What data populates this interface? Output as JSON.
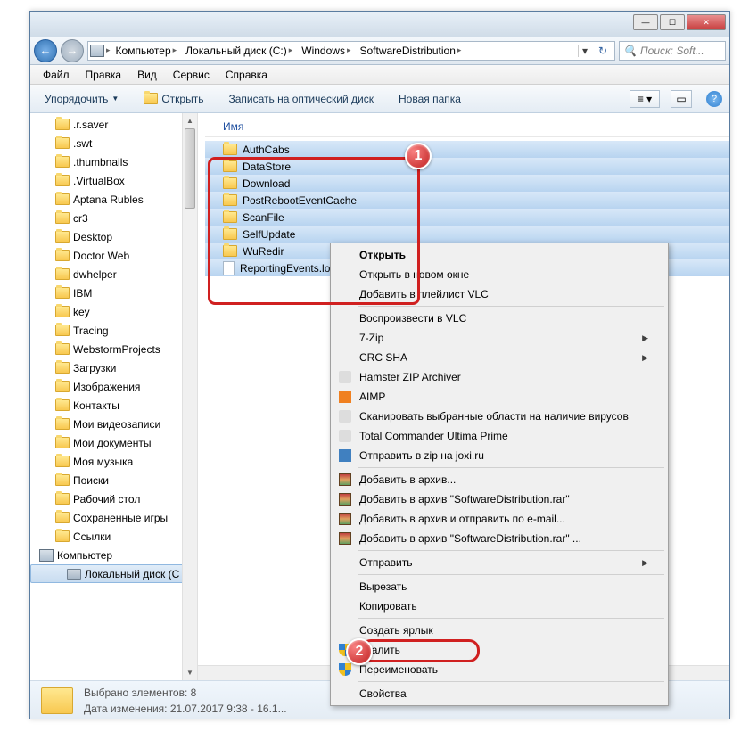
{
  "window": {
    "min": "—",
    "max": "☐",
    "close": "✕"
  },
  "nav": {
    "back": "←",
    "forward": "→",
    "refresh": "↻",
    "search_placeholder": "Поиск: Soft..."
  },
  "breadcrumbs": [
    "Компьютер",
    "Локальный диск (C:)",
    "Windows",
    "SoftwareDistribution"
  ],
  "menu": [
    "Файл",
    "Правка",
    "Вид",
    "Сервис",
    "Справка"
  ],
  "toolbar": {
    "organize": "Упорядочить",
    "open": "Открыть",
    "burn": "Записать на оптический диск",
    "newfolder": "Новая папка",
    "help": "?"
  },
  "sidebar": {
    "items": [
      {
        "label": ".r.saver",
        "icon": "folder",
        "indent": 1
      },
      {
        "label": ".swt",
        "icon": "folder",
        "indent": 1
      },
      {
        "label": ".thumbnails",
        "icon": "folder",
        "indent": 1
      },
      {
        "label": ".VirtualBox",
        "icon": "folder",
        "indent": 1
      },
      {
        "label": "Aptana Rubles",
        "icon": "folder",
        "indent": 1
      },
      {
        "label": "cr3",
        "icon": "folder",
        "indent": 1
      },
      {
        "label": "Desktop",
        "icon": "folder",
        "indent": 1
      },
      {
        "label": "Doctor Web",
        "icon": "folder",
        "indent": 1
      },
      {
        "label": "dwhelper",
        "icon": "folder",
        "indent": 1
      },
      {
        "label": "IBM",
        "icon": "folder",
        "indent": 1
      },
      {
        "label": "key",
        "icon": "folder",
        "indent": 1
      },
      {
        "label": "Tracing",
        "icon": "folder",
        "indent": 1
      },
      {
        "label": "WebstormProjects",
        "icon": "folder",
        "indent": 1
      },
      {
        "label": "Загрузки",
        "icon": "folder",
        "indent": 1
      },
      {
        "label": "Изображения",
        "icon": "folder",
        "indent": 1
      },
      {
        "label": "Контакты",
        "icon": "folder",
        "indent": 1
      },
      {
        "label": "Мои видеозаписи",
        "icon": "folder",
        "indent": 1
      },
      {
        "label": "Мои документы",
        "icon": "folder",
        "indent": 1
      },
      {
        "label": "Моя музыка",
        "icon": "folder",
        "indent": 1
      },
      {
        "label": "Поиски",
        "icon": "folder",
        "indent": 1
      },
      {
        "label": "Рабочий стол",
        "icon": "folder",
        "indent": 1
      },
      {
        "label": "Сохраненные игры",
        "icon": "folder",
        "indent": 1
      },
      {
        "label": "Ссылки",
        "icon": "folder",
        "indent": 1
      },
      {
        "label": "Компьютер",
        "icon": "computer",
        "indent": 0
      },
      {
        "label": "Локальный диск (C",
        "icon": "drive",
        "indent": 2,
        "selected": true
      }
    ]
  },
  "filepane": {
    "header": "Имя",
    "items": [
      {
        "name": "AuthCabs",
        "icon": "folder",
        "sel": true
      },
      {
        "name": "DataStore",
        "icon": "folder",
        "sel": true
      },
      {
        "name": "Download",
        "icon": "folder",
        "sel": true
      },
      {
        "name": "PostRebootEventCache",
        "icon": "folder",
        "sel": true
      },
      {
        "name": "ScanFile",
        "icon": "folder",
        "sel": true
      },
      {
        "name": "SelfUpdate",
        "icon": "folder",
        "sel": true
      },
      {
        "name": "WuRedir",
        "icon": "folder",
        "sel": true
      },
      {
        "name": "ReportingEvents.lo",
        "icon": "file",
        "sel": true
      }
    ]
  },
  "context_menu": [
    {
      "label": "Открыть",
      "bold": true
    },
    {
      "label": "Открыть в новом окне"
    },
    {
      "label": "Добавить в плейлист VLC"
    },
    {
      "sep": true
    },
    {
      "label": "Воспроизвести в VLC"
    },
    {
      "label": "7-Zip",
      "sub": true
    },
    {
      "label": "CRC SHA",
      "sub": true
    },
    {
      "label": "Hamster ZIP Archiver",
      "icon": "small"
    },
    {
      "label": "AIMP",
      "icon": "orange"
    },
    {
      "label": "Сканировать выбранные области на наличие вирусов",
      "icon": "small"
    },
    {
      "label": "Total Commander Ultima Prime",
      "icon": "small"
    },
    {
      "label": "Отправить в zip на joxi.ru",
      "icon": "blue"
    },
    {
      "sep": true
    },
    {
      "label": "Добавить в архив...",
      "icon": "rar"
    },
    {
      "label": "Добавить в архив \"SoftwareDistribution.rar\"",
      "icon": "rar"
    },
    {
      "label": "Добавить в архив и отправить по e-mail...",
      "icon": "rar"
    },
    {
      "label": "Добавить в архив \"SoftwareDistribution.rar\" ...",
      "icon": "rar"
    },
    {
      "sep": true
    },
    {
      "label": "Отправить",
      "sub": true
    },
    {
      "sep": true
    },
    {
      "label": "Вырезать"
    },
    {
      "label": "Копировать"
    },
    {
      "sep": true
    },
    {
      "label": "Создать ярлык"
    },
    {
      "label": "Удалить",
      "icon": "shield"
    },
    {
      "label": "Переименовать",
      "icon": "shield"
    },
    {
      "sep": true
    },
    {
      "label": "Свойства"
    }
  ],
  "status": {
    "selected": "Выбрано элементов: 8",
    "modified": "Дата изменения: 21.07.2017 9:38 - 16.1..."
  },
  "badges": {
    "b1": "1",
    "b2": "2"
  }
}
